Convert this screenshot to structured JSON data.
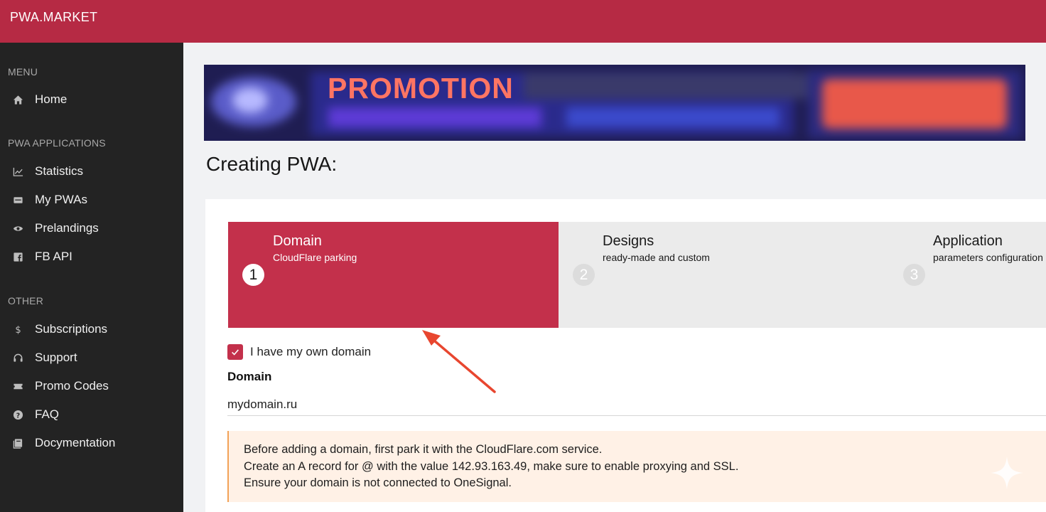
{
  "app": {
    "brand": "PWA.MARKET"
  },
  "sidebar": {
    "sections": [
      {
        "title": "MENU",
        "items": [
          {
            "label": "Home",
            "icon": "home-icon"
          }
        ]
      },
      {
        "title": "PWA APPLICATIONS",
        "items": [
          {
            "label": "Statistics",
            "icon": "chart-line-icon"
          },
          {
            "label": "My PWAs",
            "icon": "card-icon"
          },
          {
            "label": "Prelandings",
            "icon": "eye-icon"
          },
          {
            "label": "FB API",
            "icon": "facebook-icon"
          }
        ]
      },
      {
        "title": "OTHER",
        "items": [
          {
            "label": "Subscriptions",
            "icon": "dollar-icon"
          },
          {
            "label": "Support",
            "icon": "headset-icon"
          },
          {
            "label": "Promo Codes",
            "icon": "ticket-icon"
          },
          {
            "label": "FAQ",
            "icon": "question-icon"
          },
          {
            "label": "Docymentation",
            "icon": "book-icon"
          }
        ]
      }
    ]
  },
  "banner": {
    "title": "PROMOTION"
  },
  "page": {
    "title": "Creating PWA:"
  },
  "steps": [
    {
      "num": "1",
      "title": "Domain",
      "subtitle": "CloudFlare parking",
      "active": true
    },
    {
      "num": "2",
      "title": "Designs",
      "subtitle": "ready-made and custom",
      "active": false
    },
    {
      "num": "3",
      "title": "Application",
      "subtitle": "parameters configuration",
      "active": false
    }
  ],
  "form": {
    "own_domain_label": "I have my own domain",
    "own_domain_checked": true,
    "domain_label": "Domain",
    "domain_value": "mydomain.ru"
  },
  "notice": {
    "lines": [
      "Before adding a domain, first park it with the CloudFlare.com service.",
      "Create an A record for @ with the value 142.93.163.49, make sure to enable proxying and SSL.",
      "Ensure your domain is not connected to OneSignal."
    ]
  },
  "colors": {
    "brand": "#b62a44",
    "active_step": "#c3304b",
    "sidebar": "#232323",
    "notice_bg": "#fff1e6",
    "notice_border": "#f2a257",
    "arrow": "#e8462f"
  }
}
